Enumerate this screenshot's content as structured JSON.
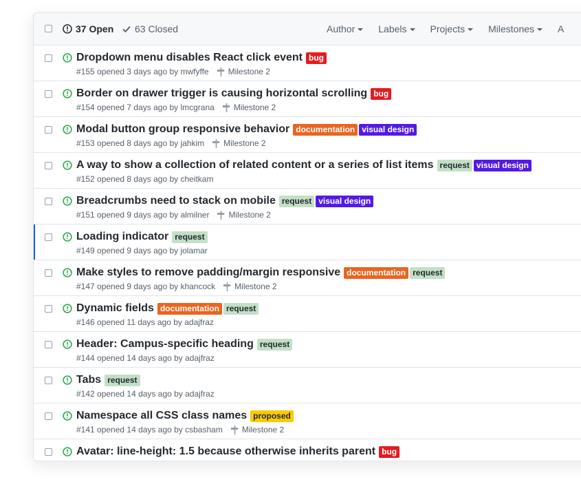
{
  "header": {
    "open_label": "37 Open",
    "closed_label": "63 Closed",
    "filters": [
      "Author",
      "Labels",
      "Projects",
      "Milestones",
      "A"
    ]
  },
  "colors": {
    "bug": "#e11d21",
    "documentation": "#eb6420",
    "visual design": "#5319e7",
    "request": "#c2e0c6",
    "proposed": "#fbca04",
    "open_icon": "#28a745"
  },
  "issues": [
    {
      "title": "Dropdown menu disables React click event",
      "labels": [
        "bug"
      ],
      "meta": "#155 opened 3 days ago by mwfyffe",
      "milestone": "Milestone 2"
    },
    {
      "title": "Border on drawer trigger is causing horizontal scrolling",
      "labels": [
        "bug"
      ],
      "meta": "#154 opened 7 days ago by lmcgrana",
      "milestone": "Milestone 2"
    },
    {
      "title": "Modal button group responsive behavior",
      "labels": [
        "documentation",
        "visual design"
      ],
      "meta": "#153 opened 8 days ago by jahkim",
      "milestone": "Milestone 2"
    },
    {
      "title": "A way to show a collection of related content or a series of list items",
      "labels": [
        "request",
        "visual design"
      ],
      "meta": "#152 opened 8 days ago by cheitkam",
      "milestone": ""
    },
    {
      "title": "Breadcrumbs need to stack on mobile",
      "labels": [
        "request",
        "visual design"
      ],
      "meta": "#151 opened 9 days ago by almilner",
      "milestone": "Milestone 2"
    },
    {
      "title": "Loading indicator",
      "labels": [
        "request"
      ],
      "meta": "#149 opened 9 days ago by jolamar",
      "milestone": ""
    },
    {
      "title": "Make styles to remove padding/margin responsive",
      "labels": [
        "documentation",
        "request"
      ],
      "meta": "#147 opened 9 days ago by khancock",
      "milestone": "Milestone 2"
    },
    {
      "title": "Dynamic fields",
      "labels": [
        "documentation",
        "request"
      ],
      "meta": "#146 opened 11 days ago by adajfraz",
      "milestone": ""
    },
    {
      "title": "Header: Campus-specific heading",
      "labels": [
        "request"
      ],
      "meta": "#144 opened 14 days ago by adajfraz",
      "milestone": ""
    },
    {
      "title": "Tabs",
      "labels": [
        "request"
      ],
      "meta": "#142 opened 14 days ago by adajfraz",
      "milestone": ""
    },
    {
      "title": "Namespace all CSS class names",
      "labels": [
        "proposed"
      ],
      "meta": "#141 opened 14 days ago by csbasham",
      "milestone": "Milestone 2"
    },
    {
      "title": "Avatar: line-height: 1.5 because otherwise inherits parent",
      "labels": [
        "bug"
      ],
      "meta": "",
      "milestone": ""
    }
  ]
}
